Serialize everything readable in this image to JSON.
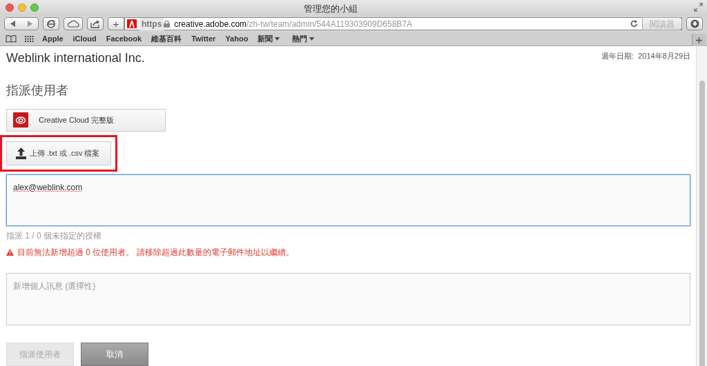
{
  "window": {
    "title": "管理您的小組"
  },
  "toolbar": {
    "address": {
      "scheme": "https",
      "host": "creative.adobe.com",
      "path": "/zh-tw/team/admin/544A119303909D658B7A"
    },
    "reader_button": {
      "label": "閱讀器",
      "disabled": true
    },
    "new_tab": "+"
  },
  "bookmarks": [
    {
      "label": "Apple",
      "kind": "link"
    },
    {
      "label": "iCloud",
      "kind": "link"
    },
    {
      "label": "Facebook",
      "kind": "link"
    },
    {
      "label": "維基百科",
      "kind": "link"
    },
    {
      "label": "Twitter",
      "kind": "link"
    },
    {
      "label": "Yahoo",
      "kind": "link"
    },
    {
      "label": "新聞",
      "kind": "folder"
    },
    {
      "label": "熱門",
      "kind": "folder"
    }
  ],
  "page": {
    "company": "Weblink international Inc.",
    "anniversary_label": "週年日期:",
    "anniversary_date": "2014年8月29日",
    "heading": "指派使用者",
    "product_button": "Creative Cloud 完整版",
    "upload_button": {
      "label": "上傳 .txt 或 .csv 檔案",
      "highlighted": true
    },
    "emails_field": {
      "value": "alex@weblink.com",
      "focused": true
    },
    "license_count": "指派 1 / 0 個未指定的授權",
    "error": "目前無法新增超過 0 位使用者。 請移除超過此數量的電子郵件地址以繼續。",
    "message_field": {
      "placeholder": "新增個人訊息 (選擇性)"
    },
    "buttons": [
      {
        "label": "指派使用者",
        "disabled": true
      },
      {
        "label": "取消",
        "disabled": false
      }
    ]
  }
}
